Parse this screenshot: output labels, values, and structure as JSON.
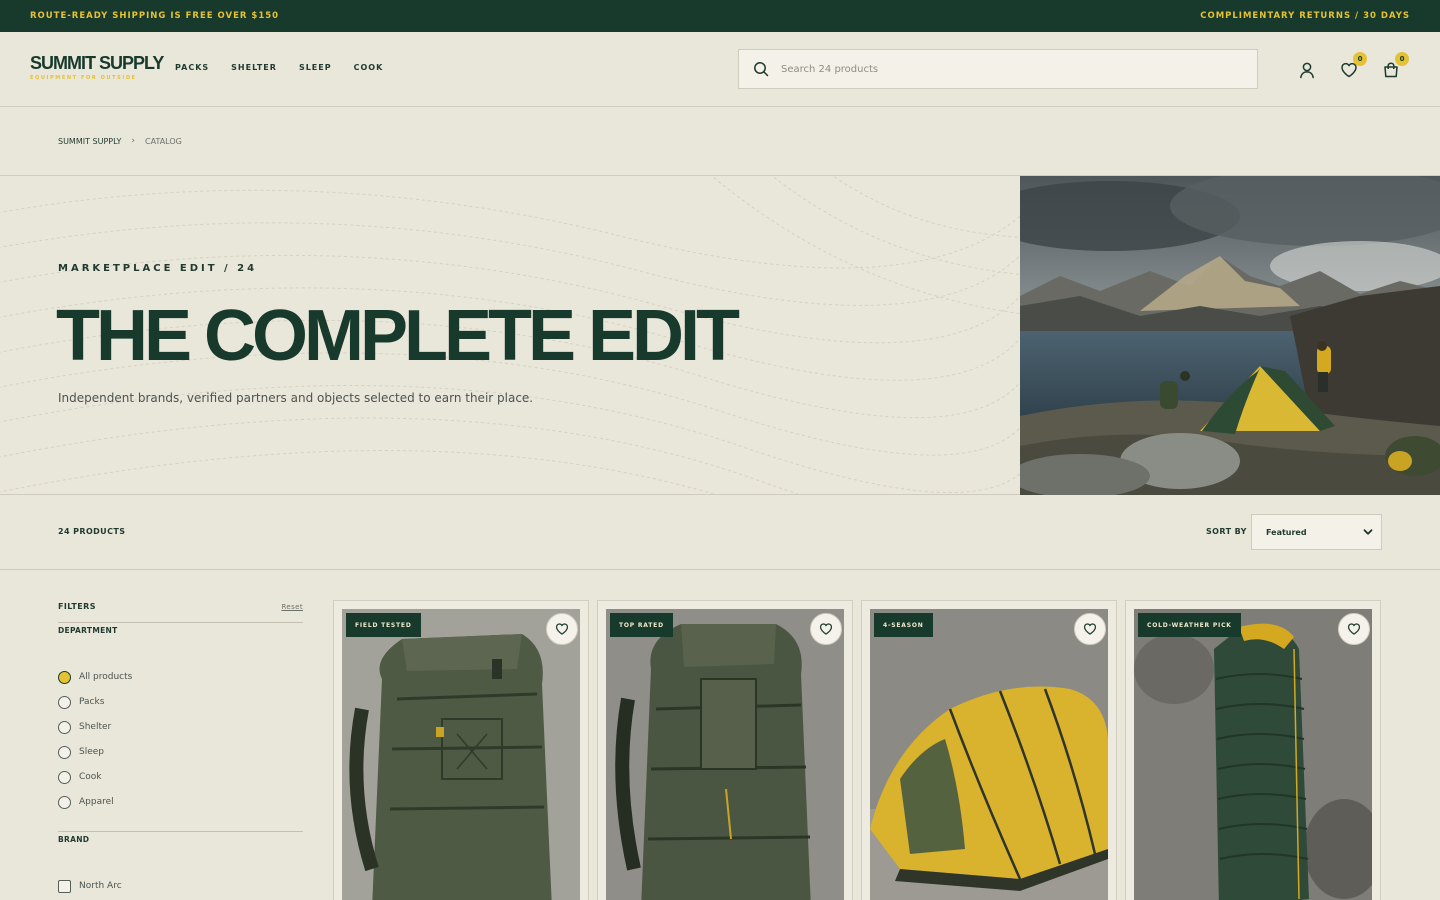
{
  "promo": {
    "left": "ROUTE-READY SHIPPING IS FREE OVER $150",
    "right": "COMPLIMENTARY RETURNS / 30 DAYS"
  },
  "header": {
    "logo_name": "SUMMIT SUPPLY",
    "logo_tagline": "EQUIPMENT FOR OUTSIDE",
    "nav": [
      "PACKS",
      "SHELTER",
      "SLEEP",
      "COOK"
    ],
    "search_placeholder": "Search 24 products",
    "wishlist_count": "0",
    "cart_count": "0"
  },
  "breadcrumb": [
    "SUMMIT SUPPLY",
    "CATALOG"
  ],
  "hero": {
    "eyebrow": "MARKETPLACE EDIT / 24",
    "title": "THE COMPLETE EDIT",
    "subtitle": "Independent brands, verified partners and objects selected to earn their place."
  },
  "toolbar": {
    "count": "24 PRODUCTS",
    "sort_label": "SORT BY",
    "sort_value": "Featured"
  },
  "filters": {
    "title": "FILTERS",
    "reset": "Reset",
    "department_title": "DEPARTMENT",
    "departments": [
      "All products",
      "Packs",
      "Shelter",
      "Sleep",
      "Cook",
      "Apparel"
    ],
    "selected_department": "All products",
    "brand_title": "BRAND",
    "brands": [
      "North Arc"
    ]
  },
  "products": [
    {
      "tag": "FIELD TESTED"
    },
    {
      "tag": "TOP RATED"
    },
    {
      "tag": "4-SEASON"
    },
    {
      "tag": "COLD-WEATHER PICK"
    }
  ],
  "colors": {
    "brand_green": "#173a2c",
    "accent_yellow": "#e5c234",
    "background": "#e9e6da"
  }
}
